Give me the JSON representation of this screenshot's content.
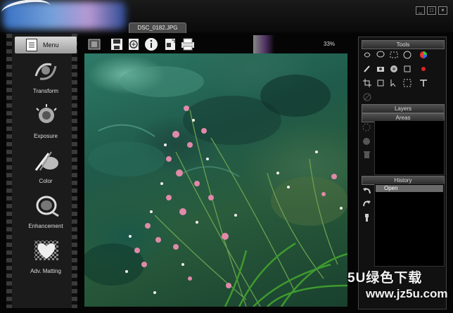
{
  "window": {
    "file_tab": "DSC_0182.JPG",
    "controls": [
      "_",
      "□",
      "×"
    ]
  },
  "sidebar": {
    "menu_label": "Menu",
    "items": [
      {
        "label": "Transform",
        "icon": "transform-icon"
      },
      {
        "label": "Exposure",
        "icon": "exposure-icon"
      },
      {
        "label": "Color",
        "icon": "color-icon"
      },
      {
        "label": "Enhancement",
        "icon": "enhancement-icon"
      },
      {
        "label": "Adv. Matting",
        "icon": "matting-icon"
      }
    ]
  },
  "toolbar": {
    "zoom": "33%",
    "icons": [
      "film-icon",
      "save-icon",
      "add-icon",
      "info-icon",
      "export-icon",
      "print-icon"
    ]
  },
  "right_panel": {
    "tools_label": "Tools",
    "layers_label": "Layers",
    "areas_label": "Areas",
    "history_label": "History",
    "history_items": [
      "Open"
    ]
  },
  "watermark": {
    "line1": "5U绿色下载",
    "line2": "www.jz5u.com"
  },
  "colors": {
    "background": "#050505",
    "panel": "#1b1b1b",
    "canvas_green": "#2e7a68"
  }
}
